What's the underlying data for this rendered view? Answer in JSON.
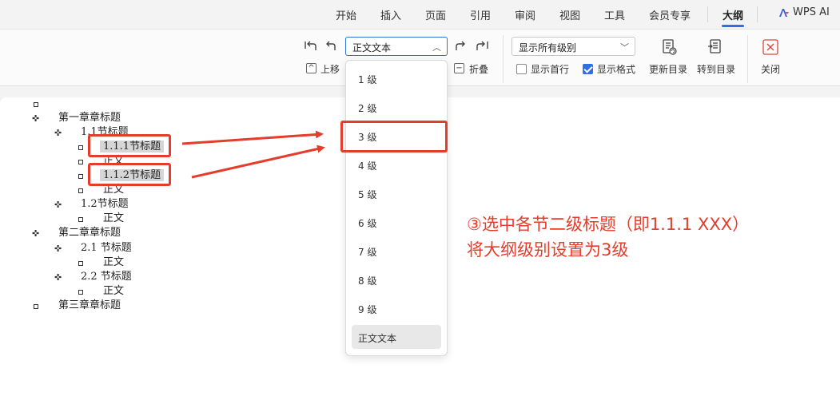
{
  "menu": {
    "items": [
      "开始",
      "插入",
      "页面",
      "引用",
      "审阅",
      "视图",
      "工具",
      "会员专享",
      "大纲"
    ],
    "wps_ai": "WPS AI"
  },
  "ribbon": {
    "level_value": "正文文本",
    "move_up": "上移",
    "collapse": "折叠",
    "show_levels_value": "显示所有级别",
    "show_first_line": "显示首行",
    "show_format": "显示格式",
    "update_toc": "更新目录",
    "goto_toc": "转到目录",
    "close": "关闭"
  },
  "outline": [
    {
      "text": "第一章章标题"
    },
    {
      "text": "1.1节标题"
    },
    {
      "text": "1.1.1节标题"
    },
    {
      "text": "正文"
    },
    {
      "text": "1.1.2节标题"
    },
    {
      "text": "正文"
    },
    {
      "text": "1.2节标题"
    },
    {
      "text": "正文"
    },
    {
      "text": "第二章章标题"
    },
    {
      "text": "2.1  节标题"
    },
    {
      "text": "正文"
    },
    {
      "text": "2.2  节标题"
    },
    {
      "text": "正文"
    },
    {
      "text": "第三章章标题"
    }
  ],
  "dropdown": {
    "options": [
      "1 级",
      "2 级",
      "3 级",
      "4 级",
      "5 级",
      "6 级",
      "7 级",
      "8 级",
      "9 级",
      "正文文本"
    ]
  },
  "annotation": {
    "line1": "③选中各节二级标题（即1.1.1 XXX）",
    "line2": "将大纲级别设置为3级"
  },
  "colors": {
    "accent": "#2f6fe0",
    "annotation_red": "#e43d2c"
  }
}
